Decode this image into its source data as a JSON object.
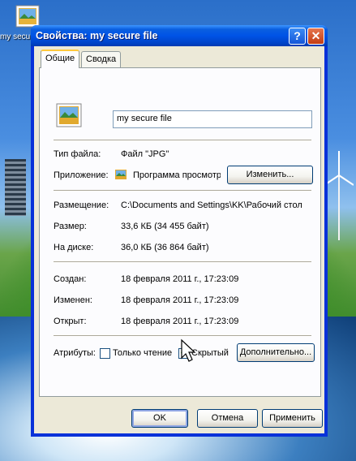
{
  "desktop": {
    "icon_label": "my secu"
  },
  "window": {
    "title": "Свойства: my secure file",
    "help_glyph": "?",
    "close_glyph": "✕"
  },
  "tabs": [
    {
      "label": "Общие",
      "active": true
    },
    {
      "label": "Сводка",
      "active": false
    }
  ],
  "general": {
    "file_name": "my secure file",
    "type_label": "Тип файла:",
    "type_value": "Файл \"JPG\"",
    "app_label": "Приложение:",
    "app_value": "Программа просмотр",
    "change_button": "Изменить...",
    "location_label": "Размещение:",
    "location_value": "C:\\Documents and Settings\\KK\\Рабочий стол",
    "size_label": "Размер:",
    "size_value": "33,6 КБ (34 455 байт)",
    "disk_label": "На диске:",
    "disk_value": "36,0 КБ (36 864 байт)",
    "created_label": "Создан:",
    "created_value": "18 февраля 2011 г., 17:23:09",
    "modified_label": "Изменен:",
    "modified_value": "18 февраля 2011 г., 17:23:09",
    "opened_label": "Открыт:",
    "opened_value": "18 февраля 2011 г., 17:23:09",
    "attributes_label": "Атрибуты:",
    "readonly_label": "Только чтение",
    "readonly_checked": false,
    "hidden_label": "Скрытый",
    "hidden_checked": true,
    "advanced_button": "Дополнительно..."
  },
  "footer": {
    "ok": "OK",
    "cancel": "Отмена",
    "apply": "Применить"
  }
}
